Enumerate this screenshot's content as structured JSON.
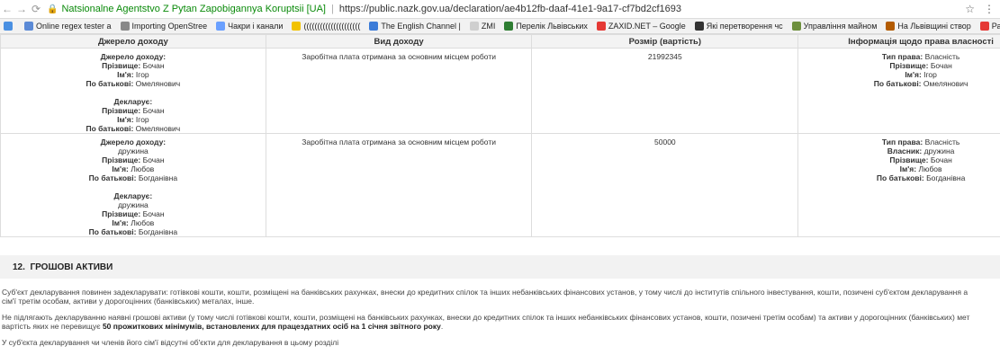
{
  "tab": {
    "title": "Natsionalne Agentstvo Z Pytan Zapobigannya Koruptsii [UA]"
  },
  "address": {
    "url": "https://public.nazk.gov.ua/declaration/ae4b12fb-daaf-41e1-9a17-cf7bd2cf1693"
  },
  "bookmarks": [
    {
      "label": "Online regex tester a",
      "color": "#5b8ad6"
    },
    {
      "label": "Importing OpenStree",
      "color": "#888888"
    },
    {
      "label": "Чакри і канали",
      "color": "#6aa0ff"
    },
    {
      "label": "(((((((((((((((((((((",
      "color": "#f2c200"
    },
    {
      "label": "The English Channel |",
      "color": "#3b7bd8"
    },
    {
      "label": "ZMI",
      "color": "#cfcfcf"
    },
    {
      "label": "Перелік Львівських",
      "color": "#2e7d32"
    },
    {
      "label": "ZAXID.NET – Google",
      "color": "#e53935"
    },
    {
      "label": "Які перетворення чс",
      "color": "#333333"
    },
    {
      "label": "Управління майном",
      "color": "#6d8f3d"
    },
    {
      "label": "На Львівщині створ",
      "color": "#b35b00"
    },
    {
      "label": "Растения против Зо",
      "color": "#e53935"
    }
  ],
  "table": {
    "headers": [
      "Джерело доходу",
      "Вид доходу",
      "Розмір (вартість)",
      "Інформація щодо права власності"
    ],
    "rows": [
      {
        "source_label": "Джерело доходу:",
        "source_relation": "",
        "surname_label": "Прізвище:",
        "surname": "Бочан",
        "name_label": "Ім'я:",
        "name": "Ігор",
        "patronymic_label": "По батькові:",
        "patronymic": "Омелянович",
        "declarant_label": "Декларує:",
        "decl_relation": "",
        "decl_surname": "Бочан",
        "decl_name": "Ігор",
        "decl_patronymic": "Омелянович",
        "income_type": "Заробітна плата отримана за основним місцем роботи",
        "amount": "21992345",
        "right_type_label": "Тип права:",
        "right_type": "Власність",
        "owner_label": "",
        "owner": "",
        "r_surname": "Бочан",
        "r_name": "Ігор",
        "r_patronymic": "Омелянович"
      },
      {
        "source_label": "Джерело доходу:",
        "source_relation": "дружина",
        "surname_label": "Прізвище:",
        "surname": "Бочан",
        "name_label": "Ім'я:",
        "name": "Любов",
        "patronymic_label": "По батькові:",
        "patronymic": "Богданівна",
        "declarant_label": "Декларує:",
        "decl_relation": "дружина",
        "decl_surname": "Бочан",
        "decl_name": "Любов",
        "decl_patronymic": "Богданівна",
        "income_type": "Заробітна плата отримана за основним місцем роботи",
        "amount": "50000",
        "right_type_label": "Тип права:",
        "right_type": "Власність",
        "owner_label": "Власник:",
        "owner": "дружина",
        "r_surname": "Бочан",
        "r_name": "Любов",
        "r_patronymic": "Богданівна"
      }
    ]
  },
  "section": {
    "number": "12.",
    "title": "ГРОШОВІ АКТИВИ",
    "p1": "Суб'єкт декларування повинен задекларувати: готівкові кошти, кошти, розміщені на банківських рахунках, внески до кредитних спілок та інших небанківських фінансових установ, у тому числі до інститутів спільного інвестування, кошти, позичені суб'єктом декларування а",
    "p1b": "сім'ї третім особам, активи у дорогоцінних (банківських) металах, інше.",
    "p2": "Не підлягають декларуванню наявні грошові активи (у тому числі готівкові кошти, кошти, розміщені на банківських рахунках, внески до кредитних спілок та інших небанківських фінансових установ, кошти, позичені третім особам) та активи у дорогоцінних (банківських) мет",
    "p2b_pre": "вартість яких не перевищує ",
    "p2b_strong": "50 прожиткових мінімумів, встановлених для працездатних осіб на 1 січня звітного року",
    "p2b_post": ".",
    "p3": "У суб'єкта декларування чи членів його сім'ї відсутні об'єкти для декларування в цьому розділі"
  }
}
